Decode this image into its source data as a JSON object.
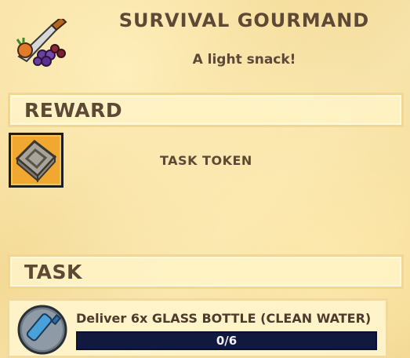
{
  "quest": {
    "title": "SURVIVAL GOURMAND",
    "subtitle": "A light snack!",
    "icon": "knife-and-fruit-icon"
  },
  "reward": {
    "heading": "REWARD",
    "item_name": "TASK TOKEN",
    "item_icon": "task-token-icon"
  },
  "task": {
    "heading": "TASK",
    "description": "Deliver 6x GLASS BOTTLE (CLEAN WATER)",
    "item_icon": "glass-bottle-icon",
    "progress_text": "0/6",
    "progress_current": 0,
    "progress_total": 6
  },
  "colors": {
    "text": "#5e4936",
    "progress_bg": "#111a3e",
    "reward_slot": "#f0a830"
  }
}
